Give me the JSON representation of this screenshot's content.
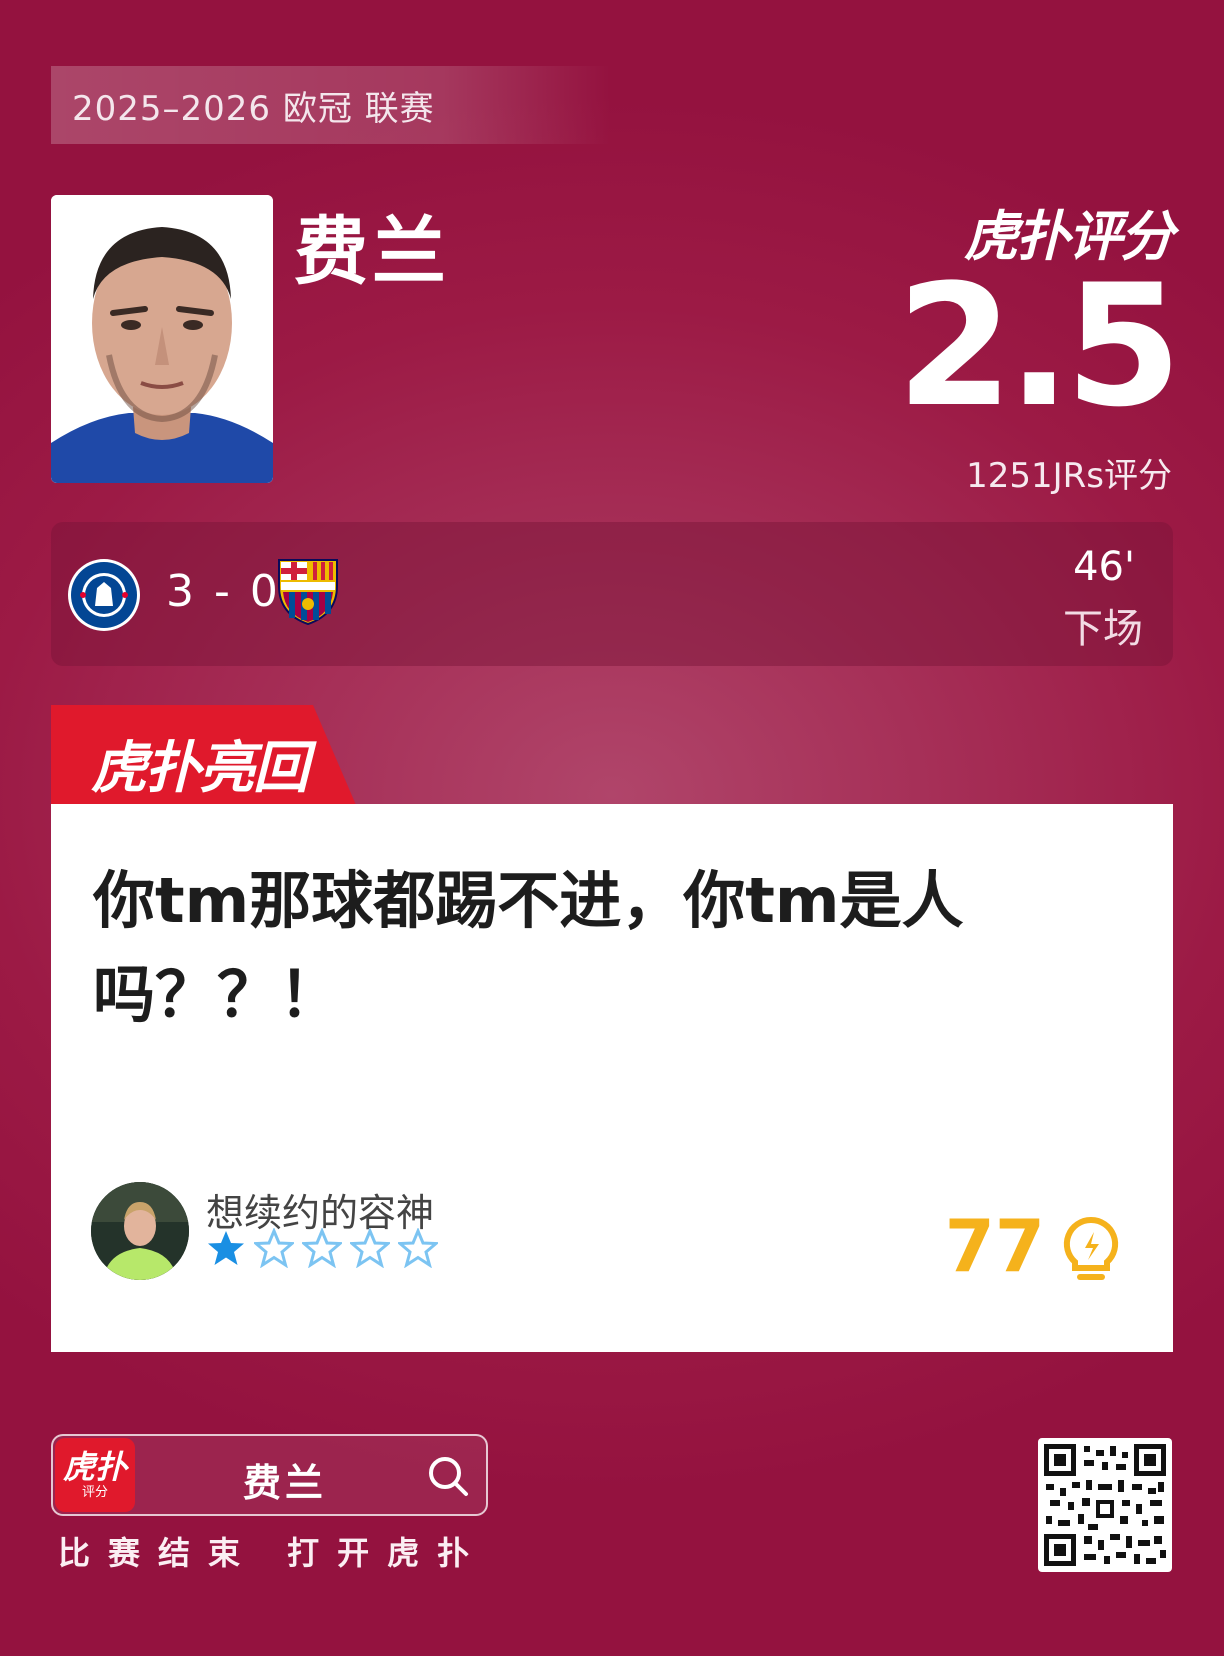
{
  "header": {
    "season_label": "2025–2026 欧冠 联赛"
  },
  "player": {
    "name": "费兰"
  },
  "brand": {
    "logo_text": "虎扑评分"
  },
  "rating": {
    "score": "2.5",
    "count_label": "1251JRs评分"
  },
  "match": {
    "home_crest": "chelsea-crest",
    "away_crest": "barcelona-crest",
    "score": "3 - 0",
    "minute": "46'",
    "sub_status": "下场"
  },
  "hot_reply": {
    "tab_label": "虎扑亮回复",
    "comment_line1": "你tm那球都踢不进，你tm是人",
    "comment_line2": "吗？？！",
    "username": "想续约的容神",
    "stars_filled": 1,
    "stars_total": 5,
    "like_count": "77",
    "colors": {
      "accent": "#f5b21c",
      "star_filled": "#1a8fe3",
      "star_empty": "#7cc4f2"
    }
  },
  "footer": {
    "app_icon_title": "虎扑",
    "app_icon_subtitle": "评分",
    "search_text": "费兰",
    "cta": "比赛结束 打开虎扑"
  },
  "colors": {
    "background": "#9c1a45",
    "brand_red": "#e0192c"
  }
}
